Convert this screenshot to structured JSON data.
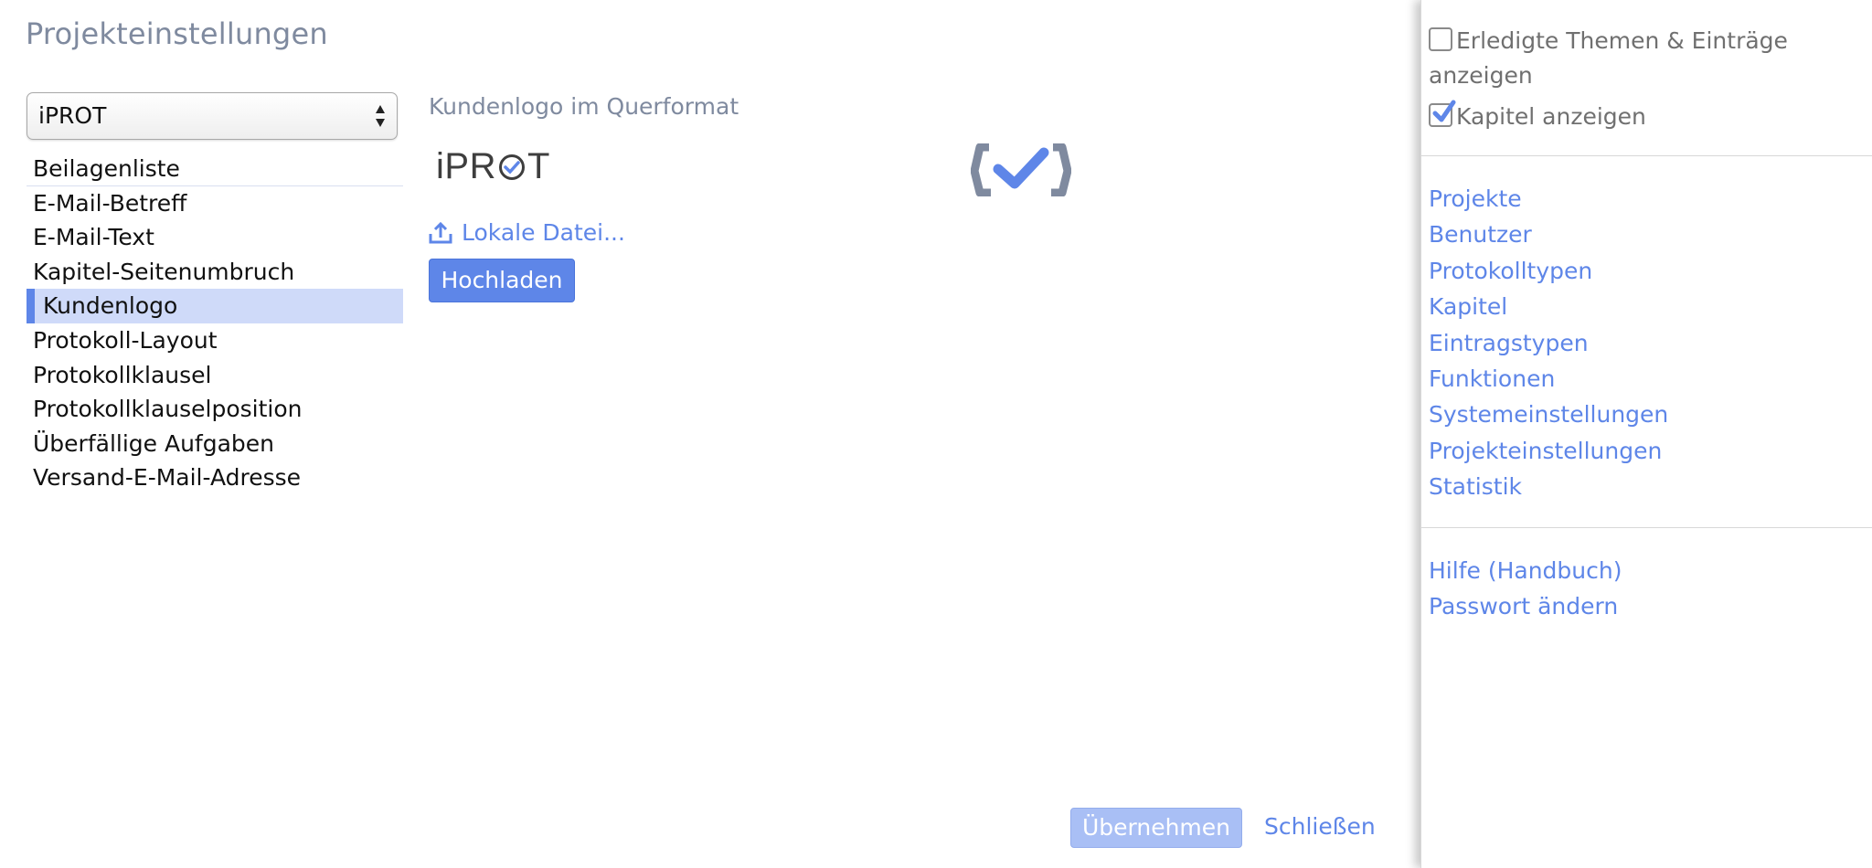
{
  "page_title": "Projekteinstellungen",
  "project_select": {
    "value": "iPROT"
  },
  "settings": [
    {
      "label": "Beilagenliste"
    },
    {
      "label": "E-Mail-Betreff"
    },
    {
      "label": "E-Mail-Text"
    },
    {
      "label": "Kapitel-Seitenumbruch"
    },
    {
      "label": "Kundenlogo",
      "selected": true
    },
    {
      "label": "Protokoll-Layout"
    },
    {
      "label": "Protokollklausel"
    },
    {
      "label": "Protokollklauselposition"
    },
    {
      "label": "Überfällige Aufgaben"
    },
    {
      "label": "Versand-E-Mail-Adresse"
    }
  ],
  "detail": {
    "section_label": "Kundenlogo im Querformat",
    "logo_text_pre": "iPR",
    "logo_text_post": "T",
    "local_file_label": "Lokale Datei...",
    "upload_label": "Hochladen",
    "icons": {
      "upload": "upload-icon",
      "logo_mark": "check-logo-icon"
    }
  },
  "footer": {
    "apply_label": "Übernehmen",
    "close_label": "Schließen"
  },
  "side_panel": {
    "checkboxes": [
      {
        "label_line1": "Erledigte Themen & Einträge",
        "label_line2": "anzeigen",
        "checked": false
      },
      {
        "label_line1": "Kapitel anzeigen",
        "checked": true
      }
    ],
    "nav_main": [
      "Projekte",
      "Benutzer",
      "Protokolltypen",
      "Kapitel",
      "Eintragstypen",
      "Funktionen",
      "Systemeinstellungen",
      "Projekteinstellungen",
      "Statistik"
    ],
    "nav_help": [
      "Hilfe (Handbuch)",
      "Passwort ändern"
    ]
  },
  "colors": {
    "accent": "#5e86e8",
    "accent_light": "#cfdaf9",
    "title_gray": "#7f8a9f",
    "apply_disabled": "#a9bff5"
  }
}
